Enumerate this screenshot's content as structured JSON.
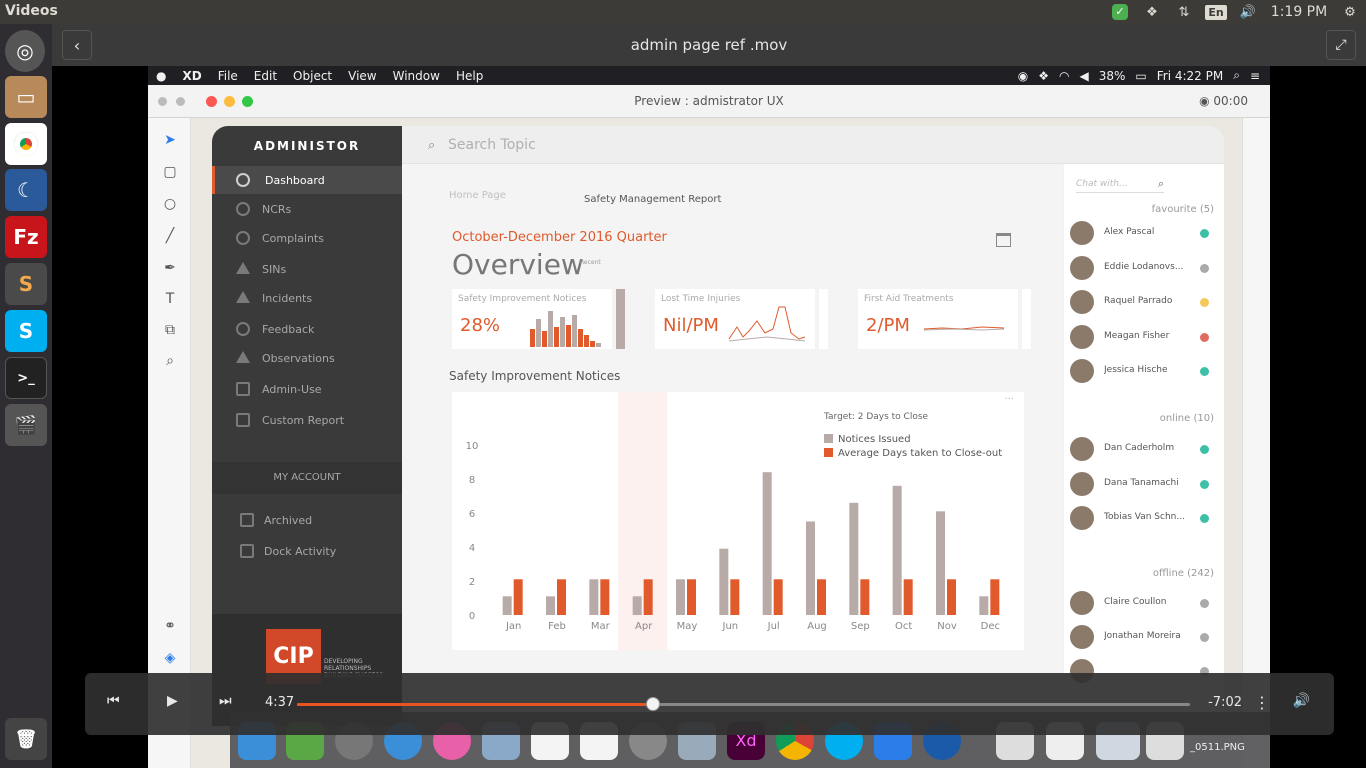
{
  "ubuntu": {
    "app_title": "Videos",
    "lang": "En",
    "clock": "1:19 PM",
    "tray_icons": [
      "shield-check-icon",
      "dropbox-icon",
      "transfer-icon",
      "keyboard-lang-icon",
      "volume-icon",
      "clock",
      "gear-icon"
    ],
    "launcher": [
      "ubuntu-icon",
      "files-icon",
      "chrome-icon",
      "mandriva-icon",
      "filezilla-icon",
      "sublime-icon",
      "skype-beta-icon",
      "terminal-icon",
      "clapper-icon",
      "trash-icon"
    ]
  },
  "player": {
    "title": "admin page ref .mov",
    "current_time": "4:37",
    "remaining_time": "-7:02",
    "progress": 0.399,
    "colors": {
      "accent": "#e95420"
    }
  },
  "mac": {
    "menus": [
      "XD",
      "File",
      "Edit",
      "Object",
      "View",
      "Window",
      "Help"
    ],
    "battery": "38%",
    "clock": "Fri 4:22 PM"
  },
  "xd": {
    "window_title": "Preview : admistrator UX",
    "timer": "00:00"
  },
  "admin": {
    "brand": "ADMINISTOR",
    "nav": [
      {
        "label": "Dashboard",
        "active": true
      },
      {
        "label": "NCRs"
      },
      {
        "label": "Complaints"
      },
      {
        "label": "SINs"
      },
      {
        "label": "Incidents"
      },
      {
        "label": "Feedback"
      },
      {
        "label": "Observations"
      },
      {
        "label": "Admin-Use"
      },
      {
        "label": "Custom Report"
      }
    ],
    "account_header": "MY ACCOUNT",
    "account_items": [
      "Archived",
      "Dock Activity"
    ],
    "logo": {
      "letters": "CIP",
      "tagline": "DEVELOPING RELATIONSHIPS BUILDING SUCCESS"
    },
    "search_placeholder": "Search Topic",
    "breadcrumb": [
      "Home Page",
      "Safety Management Report"
    ],
    "quarter": "October-December 2016 Quarter",
    "overview": "Overview",
    "overview_badge": "Recent",
    "kpis": [
      {
        "label": "Safety Improvement Notices",
        "value": "28%"
      },
      {
        "label": "Lost Time Injuries",
        "value": "Nil/PM"
      },
      {
        "label": "First Aid Treatments",
        "value": "2/PM"
      }
    ],
    "chart_section_title": "Safety Improvement Notices",
    "colors": {
      "accent": "#e05a2c",
      "issued": "#b8aaa7",
      "avg": "#e05a2c"
    },
    "chat": {
      "placeholder": "Chat with...",
      "favourite_header": "favourite (5)",
      "online_header": "online (10)",
      "offline_header": "offline (242)",
      "favourite": [
        {
          "name": "Alex Pascal",
          "status": "#3cc0a6"
        },
        {
          "name": "Eddie Lodanovs...",
          "status": "#aaaaaa"
        },
        {
          "name": "Raquel Parrado",
          "status": "#f5c85a"
        },
        {
          "name": "Meagan Fisher",
          "status": "#e06a62"
        },
        {
          "name": "Jessica Hische",
          "status": "#3cc0a6"
        }
      ],
      "online": [
        {
          "name": "Dan Caderholm",
          "status": "#3cc0a6"
        },
        {
          "name": "Dana Tanamachi",
          "status": "#3cc0a6"
        },
        {
          "name": "Tobias Van Schn...",
          "status": "#3cc0a6"
        }
      ],
      "offline": [
        {
          "name": "Claire Coullon",
          "status": "#aaaaaa"
        },
        {
          "name": "Jonathan Moreira",
          "status": "#aaaaaa"
        },
        {
          "name": "",
          "status": "#aaaaaa"
        }
      ]
    }
  },
  "dock": {
    "file_label": "_0511.PNG"
  },
  "chart_data": {
    "type": "bar",
    "title": "Target: 2 Days to Close",
    "categories": [
      "Jan",
      "Feb",
      "Mar",
      "Apr",
      "May",
      "Jun",
      "Jul",
      "Aug",
      "Sep",
      "Oct",
      "Nov",
      "Dec"
    ],
    "ylim": [
      0,
      10
    ],
    "yticks": [
      0,
      2,
      4,
      6,
      8,
      10
    ],
    "highlight": "Apr",
    "legend": "top-right",
    "series": [
      {
        "name": "Notices Issued",
        "values": [
          1.1,
          1.1,
          2.1,
          1.1,
          2.1,
          3.9,
          8.4,
          5.5,
          6.6,
          7.6,
          6.1,
          1.1
        ]
      },
      {
        "name": "Average Days taken to Close-out",
        "values": [
          2.1,
          2.1,
          2.1,
          2.1,
          2.1,
          2.1,
          2.1,
          2.1,
          2.1,
          2.1,
          2.1,
          2.1
        ]
      }
    ]
  }
}
